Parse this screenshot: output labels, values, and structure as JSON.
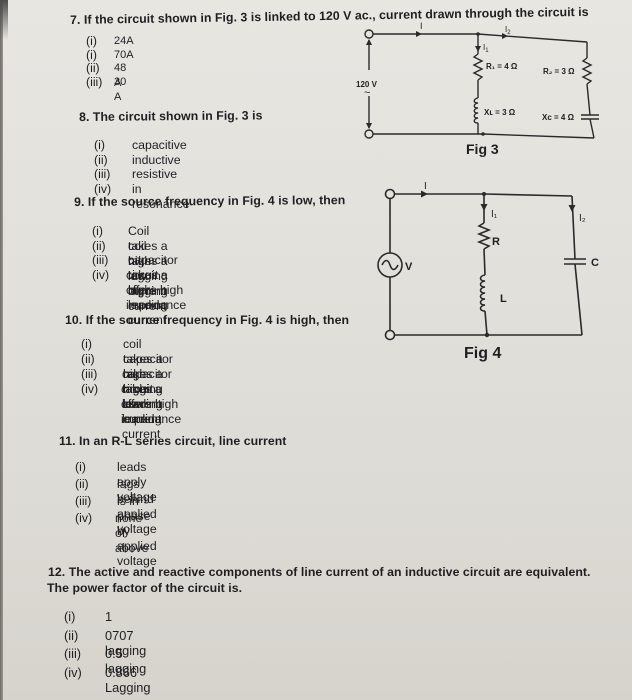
{
  "questions": [
    {
      "number": "7.",
      "text": "If the circuit shown in Fig. 3 is linked to 120 V ac., current drawn through the circuit is",
      "options": [
        {
          "label": "(i)",
          "text": "24A"
        },
        {
          "label": "(i)",
          "text": "70A"
        },
        {
          "label": "(ii)",
          "text": "48 A"
        },
        {
          "label": "(iii)",
          "text": "30 A"
        }
      ]
    },
    {
      "number": "8.",
      "text": "The circuit shown in Fig. 3 is",
      "options": [
        {
          "label": "(i)",
          "text": "capacitive"
        },
        {
          "label": "(ii)",
          "text": "inductive"
        },
        {
          "label": "(iii)",
          "text": "resistive"
        },
        {
          "label": "(iv)",
          "text": "in resonance"
        }
      ]
    },
    {
      "number": "9.",
      "text": "If the source frequency in Fig. 4 is low, then",
      "options": [
        {
          "label": "(i)",
          "text": "Coil takes a high lagging current"
        },
        {
          "label": "(ii)",
          "text": "coil takes a low lagging current"
        },
        {
          "label": "(iii)",
          "text": "capacitor takes a high leading current"
        },
        {
          "label": "(iv)",
          "text": "circuit offers high impedance"
        }
      ]
    },
    {
      "number": "10.",
      "text": "If the source frequency in Fig. 4 is high, then",
      "options": [
        {
          "label": "(i)",
          "text": "coil takes a high lagging current"
        },
        {
          "label": "(ii)",
          "text": "capacitor takes a high leading current"
        },
        {
          "label": "(iii)",
          "text": "capacitor takes a low leading current"
        },
        {
          "label": "(iv)",
          "text": "circuit offers high impedance"
        }
      ]
    },
    {
      "number": "11.",
      "text": "In an R-L series circuit, line current",
      "options": [
        {
          "label": "(i)",
          "text": "leads apply voltage"
        },
        {
          "label": "(ii)",
          "text": "lags behind applied voltage"
        },
        {
          "label": "(iii)",
          "text": "is in phase by applied voltage"
        },
        {
          "label": "(iv)",
          "text": "none of above"
        }
      ]
    },
    {
      "number": "12.",
      "text": "The active and reactive components of line current of an inductive circuit are equivalent.",
      "text2": "The power factor of the circuit is.",
      "options": [
        {
          "label": "(i)",
          "text": "1"
        },
        {
          "label": "(ii)",
          "text": "0707 lagging"
        },
        {
          "label": "(iii)",
          "text": "0.5 lagging"
        },
        {
          "label": "(iv)",
          "text": "0.866 Lagging"
        }
      ]
    }
  ],
  "fig3": {
    "caption": "Fig 3",
    "source_voltage": "120 V",
    "source_symbol": "~",
    "current_total": "I",
    "current_branch1": "I1",
    "current_branch2": "I2",
    "r1": "R₁ = 4 Ω",
    "xl": "Xʟ = 3 Ω",
    "r2": "R₂ = 3 Ω",
    "xc": "Xc = 4 Ω"
  },
  "fig4": {
    "caption": "Fig 4",
    "source_label": "V",
    "current_total": "I",
    "current_branch1": "I₁",
    "current_branch2": "I₂",
    "resistor": "R",
    "inductor": "L",
    "capacitor": "C"
  }
}
